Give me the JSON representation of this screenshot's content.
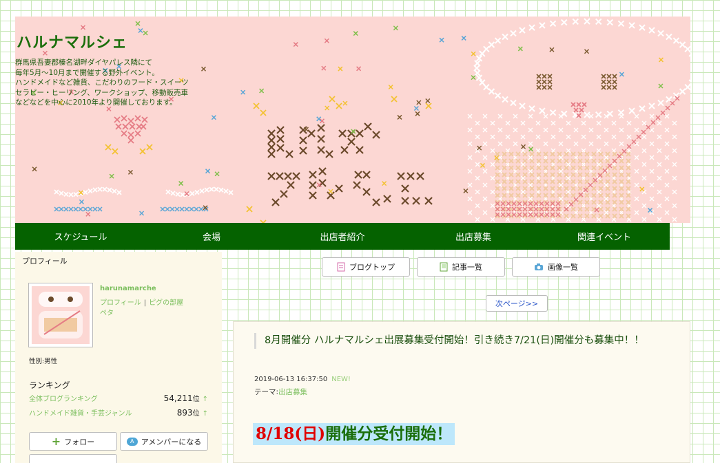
{
  "header": {
    "site_title": "ハルナマルシェ",
    "description": [
      "群馬県吾妻郡榛名湖畔ダイヤパレス隣にて",
      "毎年5月～10月まで開催する野外イベント。",
      "ハンドメイドなど雑貨、こだわりのフード・スイーツ",
      "セラピー・ヒーリング、ワークショップ、移動販売車",
      "などなどを中心に2010年より開催しております。"
    ],
    "logo_text": "ハルナマルシェ"
  },
  "nav": {
    "items": [
      "スケジュール",
      "会場",
      "出店者紹介",
      "出店募集",
      "関連イベント"
    ]
  },
  "sidebar": {
    "profile_heading": "プロフィール",
    "username": "harunamarche",
    "link_profile": "プロフィール",
    "link_room": "ピグの部屋",
    "link_peta": "ペタ",
    "gender": "性別:男性",
    "ranking_title": "ランキング",
    "rankings": [
      {
        "label": "全体ブログランキング",
        "value": "54,211",
        "unit": "位",
        "trend": "↑"
      },
      {
        "label": "ハンドメイド雑貨・手芸ジャンル",
        "value": "893",
        "unit": "位",
        "trend": "↑"
      }
    ],
    "follow_label": "フォロー",
    "amember_label": "アメンバーになる"
  },
  "toolbar": {
    "blog_top": "ブログトップ",
    "entry_list": "記事一覧",
    "image_list": "画像一覧",
    "next_page": "次ページ>>"
  },
  "article": {
    "title": "8月開催分 ハルナマルシェ出展募集受付開始！引き続き7/21(日)開催分も募集中！！",
    "datetime": "2019-06-13 16:37:50",
    "new_badge": "NEW!",
    "theme_label": "テーマ:",
    "theme_value": "出店募集",
    "headline_red": "8/18(日)",
    "headline_green": "開催分受付開始！"
  },
  "colors": {
    "nav_bg": "#056200",
    "header_bg": "#fcd7d3",
    "accent_green": "#7cbf5e"
  }
}
